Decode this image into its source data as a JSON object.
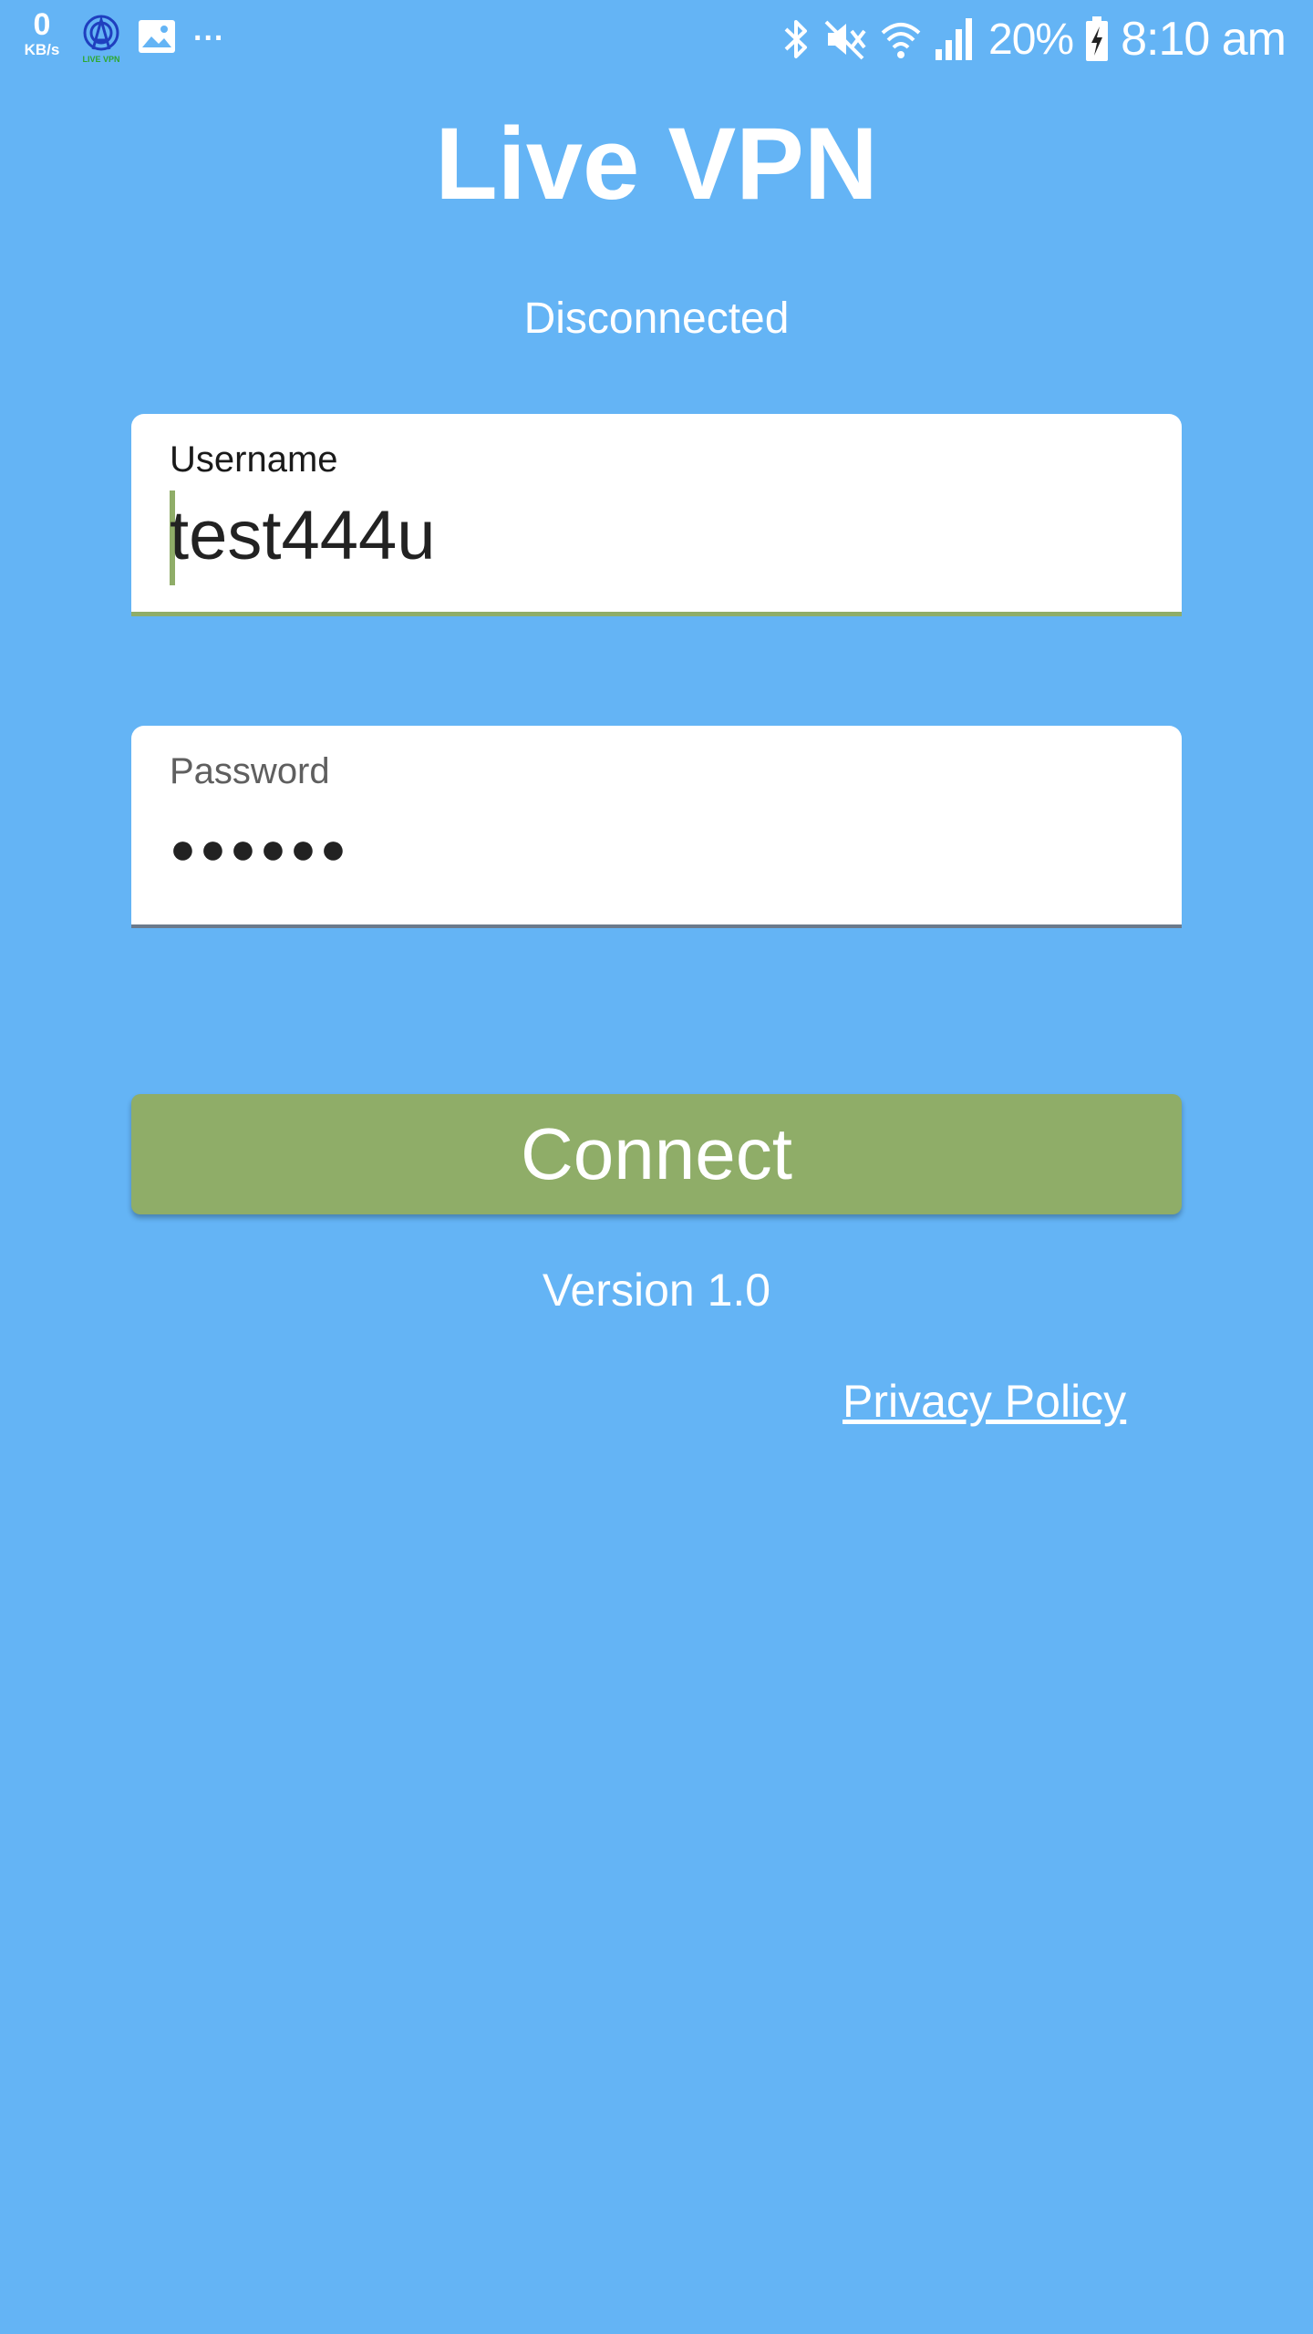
{
  "status_bar": {
    "net_speed_value": "0",
    "net_speed_unit": "KB/s",
    "vpn_badge_text": "LIVE VPN",
    "more_indicator": "...",
    "battery_percent": "20%",
    "time": "8:10 am",
    "icons": [
      "vpn-notification-icon",
      "gallery-icon",
      "bluetooth-icon",
      "mute-icon",
      "wifi-icon",
      "signal-icon",
      "battery-charging-icon"
    ]
  },
  "app": {
    "title": "Live VPN",
    "connection_status": "Disconnected"
  },
  "form": {
    "username": {
      "label": "Username",
      "value": "test444u"
    },
    "password": {
      "label": "Password",
      "masked_value": "●●●●●●"
    },
    "connect_label": "Connect"
  },
  "footer": {
    "version": "Version 1.0",
    "privacy_link": "Privacy Policy"
  },
  "colors": {
    "background": "#64b4f5",
    "accent_green": "#8fad68",
    "text_on_background": "#ffffff"
  }
}
